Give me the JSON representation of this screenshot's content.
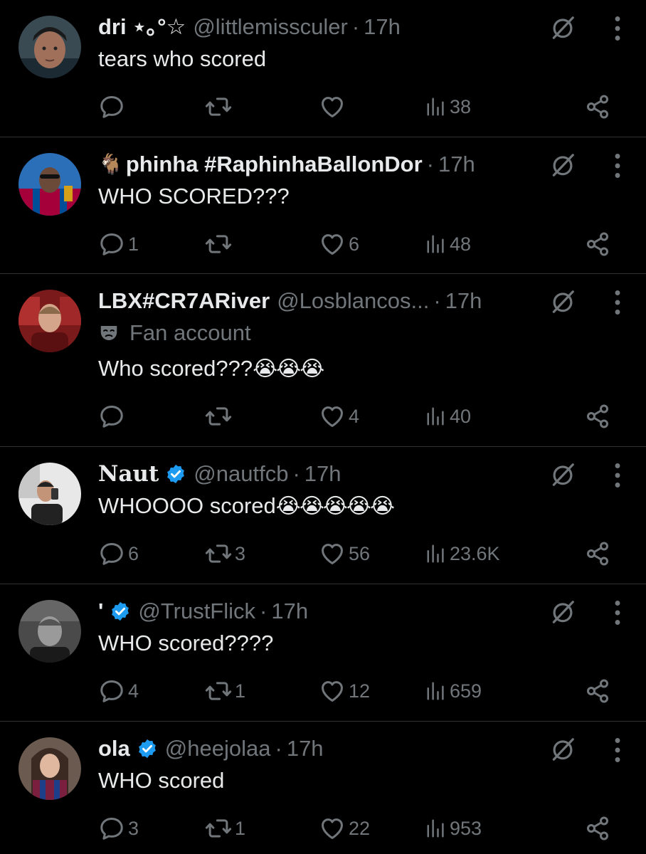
{
  "colors": {
    "background": "#000000",
    "text": "#e7e9ea",
    "secondary": "#71767b",
    "divider": "#2f3336",
    "verified": "#1d9bf0"
  },
  "tweets": [
    {
      "name": "dri ⋆｡°☆",
      "handle": "@littlemissculer",
      "dot": "·",
      "time": "17h",
      "verified": false,
      "text": "tears who scored",
      "emoji": "",
      "replies": "",
      "retweets": "",
      "likes": "",
      "views": "38"
    },
    {
      "name_prefix_emoji": "🐐",
      "name": "phinha #RaphinhaBallonDor",
      "handle": "",
      "dot": "·",
      "time": "17h",
      "verified": false,
      "text": "WHO SCORED???",
      "emoji": "",
      "replies": "1",
      "retweets": "",
      "likes": "6",
      "views": "48"
    },
    {
      "name": "LBX#CR7ARiver",
      "handle": "@Losblancos...",
      "dot": "·",
      "time": "17h",
      "verified": false,
      "label": "Fan account",
      "text": "Who scored???",
      "emoji": "😭😭😭",
      "replies": "",
      "retweets": "",
      "likes": "4",
      "views": "40"
    },
    {
      "name": "Naut",
      "handle": "@nautfcb",
      "dot": "·",
      "time": "17h",
      "verified": true,
      "text": "WHOOOO scored",
      "emoji": "😭😭😭😭😭",
      "replies": "6",
      "retweets": "3",
      "likes": "56",
      "views": "23.6K"
    },
    {
      "name": "'",
      "handle": "@TrustFlick",
      "dot": "·",
      "time": "17h",
      "verified": true,
      "text": "WHO scored????",
      "emoji": "",
      "replies": "4",
      "retweets": "1",
      "likes": "12",
      "views": "659"
    },
    {
      "name": "ola",
      "handle": "@heejolaa",
      "dot": "·",
      "time": "17h",
      "verified": true,
      "text": "WHO scored",
      "emoji": "",
      "replies": "3",
      "retweets": "1",
      "likes": "22",
      "views": "953"
    }
  ]
}
